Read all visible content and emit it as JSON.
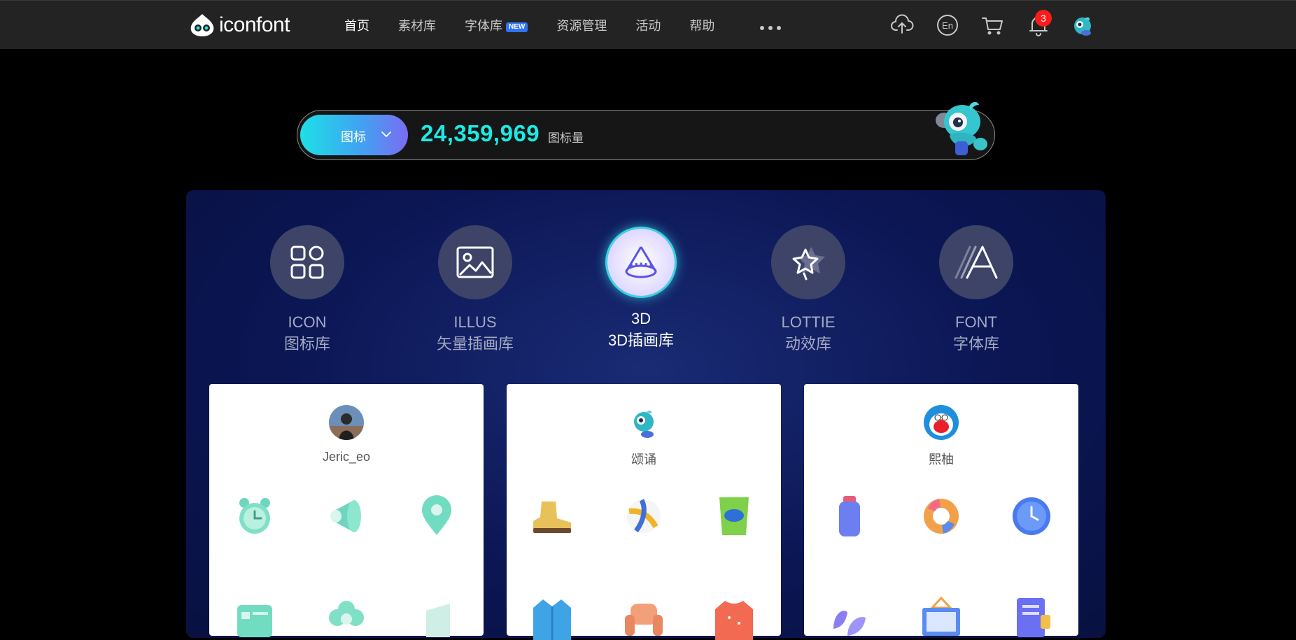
{
  "brand": {
    "name": "iconfont"
  },
  "nav": {
    "items": [
      {
        "label": "首页",
        "active": true
      },
      {
        "label": "素材库"
      },
      {
        "label": "字体库",
        "badge": "NEW"
      },
      {
        "label": "资源管理"
      },
      {
        "label": "活动"
      },
      {
        "label": "帮助"
      }
    ]
  },
  "toolbar": {
    "icons": [
      "upload-icon",
      "language-en-icon",
      "cart-icon",
      "bell-icon"
    ],
    "language_label": "En",
    "notification_count": "3"
  },
  "search": {
    "type_label": "图标",
    "count": "24,359,969",
    "count_label": "图标量"
  },
  "categories": [
    {
      "en": "ICON",
      "cn": "图标库",
      "icon": "grid-icon"
    },
    {
      "en": "ILLUS",
      "cn": "矢量插画库",
      "icon": "image-icon"
    },
    {
      "en": "3D",
      "cn": "3D插画库",
      "icon": "cone-icon",
      "active": true
    },
    {
      "en": "LOTTIE",
      "cn": "动效库",
      "icon": "star-motion-icon"
    },
    {
      "en": "FONT",
      "cn": "字体库",
      "icon": "font-icon"
    }
  ],
  "cards": [
    {
      "author": "Jeric_eo",
      "thumbs": [
        "alarm-clock-3d",
        "megaphone-3d",
        "location-pin-3d",
        "calendar-3d",
        "flower-3d",
        "glass-panel-3d"
      ]
    },
    {
      "author": "颂诵",
      "thumbs": [
        "boot-3d",
        "volleyball-3d",
        "chips-bag-3d",
        "jacket-3d",
        "armchair-3d",
        "sweater-3d"
      ]
    },
    {
      "author": "熙柚",
      "thumbs": [
        "water-bottle-3d",
        "swim-ring-3d",
        "wall-clock-3d",
        "plant-3d",
        "picture-board-3d",
        "notebook-3d"
      ]
    }
  ],
  "colors": {
    "accent": "#1de9e2",
    "topbar": "#232323",
    "panel": "#0b1654",
    "badge": "#ff1a1a"
  }
}
